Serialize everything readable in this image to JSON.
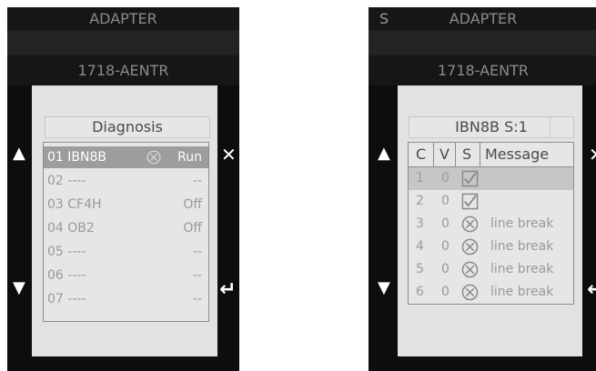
{
  "left": {
    "header_title": "ADAPTER",
    "module": "1718-AENTR",
    "screen_title": "Diagnosis",
    "items": [
      {
        "label": "01 IBN8B",
        "state": "Run",
        "selected": true,
        "icon": "x-circle-icon"
      },
      {
        "label": "02 ----",
        "state": "--"
      },
      {
        "label": "03 CF4H",
        "state": "Off"
      },
      {
        "label": "04 OB2",
        "state": "Off"
      },
      {
        "label": "05 ----",
        "state": "--"
      },
      {
        "label": "06 ----",
        "state": "--"
      },
      {
        "label": "07 ----",
        "state": "--"
      }
    ],
    "nav": {
      "up": "▲",
      "down": "▼",
      "close": "✕",
      "enter": "↵"
    }
  },
  "right": {
    "slot_label": "S",
    "header_title": "ADAPTER",
    "module": "1718-AENTR",
    "screen_title": "IBN8B S:1",
    "columns": [
      "C",
      "V",
      "S",
      "Message"
    ],
    "rows": [
      {
        "c": "1",
        "v": "0",
        "status": "check",
        "message": "",
        "selected": true
      },
      {
        "c": "2",
        "v": "0",
        "status": "check",
        "message": ""
      },
      {
        "c": "3",
        "v": "0",
        "status": "x",
        "message": "line break"
      },
      {
        "c": "4",
        "v": "0",
        "status": "x",
        "message": "line break"
      },
      {
        "c": "5",
        "v": "0",
        "status": "x",
        "message": "line break"
      },
      {
        "c": "6",
        "v": "0",
        "status": "x",
        "message": "line break"
      }
    ],
    "nav": {
      "up": "▲",
      "down": "▼",
      "close": "✕",
      "enter": "↵"
    }
  },
  "colors": {
    "background": "#0d0d0d",
    "screen": "#e2e2e2",
    "selection": "#9d9d9d",
    "text_dim": "#9a9a9a"
  }
}
